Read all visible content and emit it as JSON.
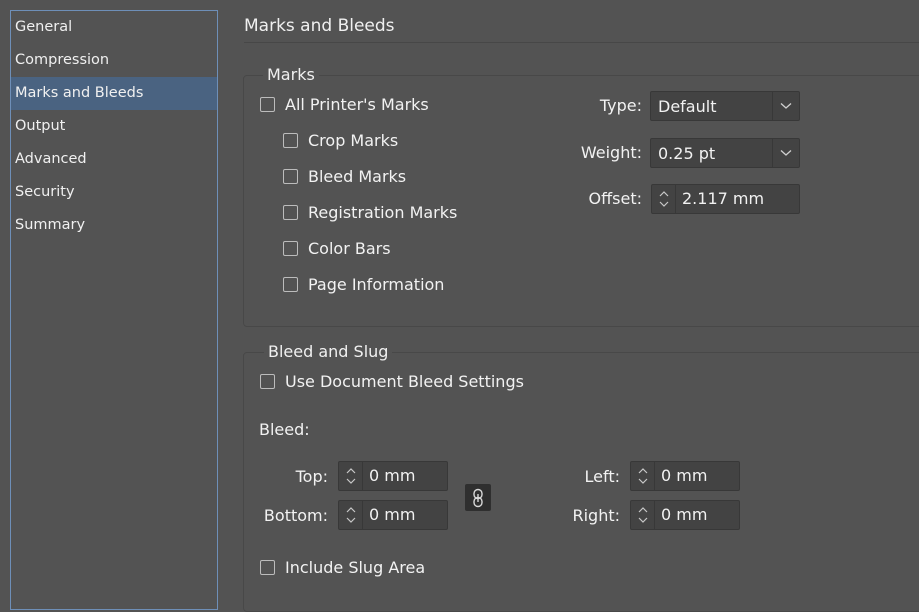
{
  "sidebar": {
    "items": [
      {
        "label": "General"
      },
      {
        "label": "Compression"
      },
      {
        "label": "Marks and Bleeds",
        "active": true
      },
      {
        "label": "Output"
      },
      {
        "label": "Advanced"
      },
      {
        "label": "Security"
      },
      {
        "label": "Summary"
      }
    ]
  },
  "page": {
    "title": "Marks and Bleeds"
  },
  "marks": {
    "group_title": "Marks",
    "all_printers_marks": "All Printer's Marks",
    "crop_marks": "Crop Marks",
    "bleed_marks": "Bleed Marks",
    "registration_marks": "Registration Marks",
    "color_bars": "Color Bars",
    "page_information": "Page Information",
    "type_label": "Type:",
    "type_value": "Default",
    "weight_label": "Weight:",
    "weight_value": "0.25 pt",
    "offset_label": "Offset:",
    "offset_value": "2.117 mm"
  },
  "bleed_slug": {
    "group_title": "Bleed and Slug",
    "use_document_bleed": "Use Document Bleed Settings",
    "bleed_label": "Bleed:",
    "top_label": "Top:",
    "top_value": "0 mm",
    "bottom_label": "Bottom:",
    "bottom_value": "0 mm",
    "left_label": "Left:",
    "left_value": "0 mm",
    "right_label": "Right:",
    "right_value": "0 mm",
    "include_slug_area": "Include Slug Area"
  },
  "colors": {
    "background": "#535353",
    "sidebar_selected": "#4a6381",
    "sidebar_border": "#6e8fb8",
    "field_bg": "#434343"
  }
}
